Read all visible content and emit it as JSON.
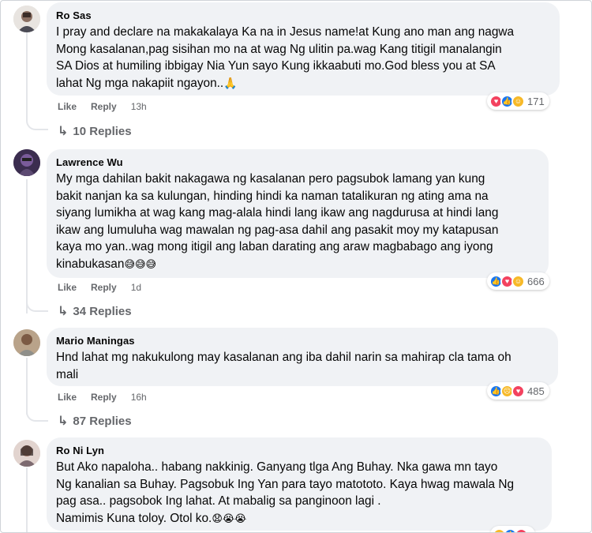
{
  "comments": [
    {
      "author": "Ro Sas",
      "lines": [
        "I pray and declare na makakalaya Ka na in Jesus name!at Kung ano man ang nagwa",
        "Mong kasalanan,pag sisihan mo na at wag Ng ulitin pa.wag Kang titigil manalangin",
        "SA Dios at humiling ibbigay Nia Yun sayo Kung ikkaabuti mo.God bless you at SA",
        "lahat Ng mga nakapiit ngayon.."
      ],
      "emoji": "🙏",
      "like_label": "Like",
      "reply_label": "Reply",
      "time": "13h",
      "reactions": [
        "love",
        "like",
        "care"
      ],
      "reaction_count": "171",
      "replies_label": "10 Replies"
    },
    {
      "author": "Lawrence Wu",
      "lines": [
        "My mga dahilan bakit nakagawa ng kasalanan pero pagsubok lamang yan kung",
        "bakit nanjan ka sa kulungan, hinding hindi ka naman tatalikuran ng ating ama na",
        "siyang lumikha at wag kang mag-alala hindi lang ikaw ang nagdurusa at hindi lang",
        "ikaw ang lumuluha wag mawalan ng pag-asa dahil ang pasakit moy my katapusan",
        "kaya mo yan..wag mong itigil ang laban darating ang araw magbabago ang iyong",
        "kinabukasan"
      ],
      "emoji": "😅😅😅",
      "like_label": "Like",
      "reply_label": "Reply",
      "time": "1d",
      "reactions": [
        "like",
        "love",
        "care"
      ],
      "reaction_count": "666",
      "replies_label": "34 Replies"
    },
    {
      "author": "Mario Maningas",
      "lines": [
        "Hnd lahat mg nakukulong may kasalanan ang iba dahil narin sa mahirap cla tama oh",
        "mali"
      ],
      "emoji": "",
      "like_label": "Like",
      "reply_label": "Reply",
      "time": "16h",
      "reactions": [
        "like",
        "sad",
        "love"
      ],
      "reaction_count": "485",
      "replies_label": "87 Replies"
    },
    {
      "author": "Ro Ni Lyn",
      "lines": [
        "But Ako napaloha.. habang nakkinig. Ganyang tlga Ang Buhay. Nka gawa mn tayo",
        "Ng kanalian sa Buhay. Pagsobuk Ing Yan para tayo matototo. Kaya hwag mawala Ng",
        "pag asa.. pagsobok Ing lahat. At mabalig sa panginoon lagi .",
        "Namimis Kuna toloy. Otol ko."
      ],
      "emoji": "😧😭😭",
      "like_label": "",
      "reply_label": "",
      "time": "",
      "reactions": [
        "care",
        "like",
        "love"
      ],
      "reaction_count": "",
      "replies_label": ""
    }
  ]
}
